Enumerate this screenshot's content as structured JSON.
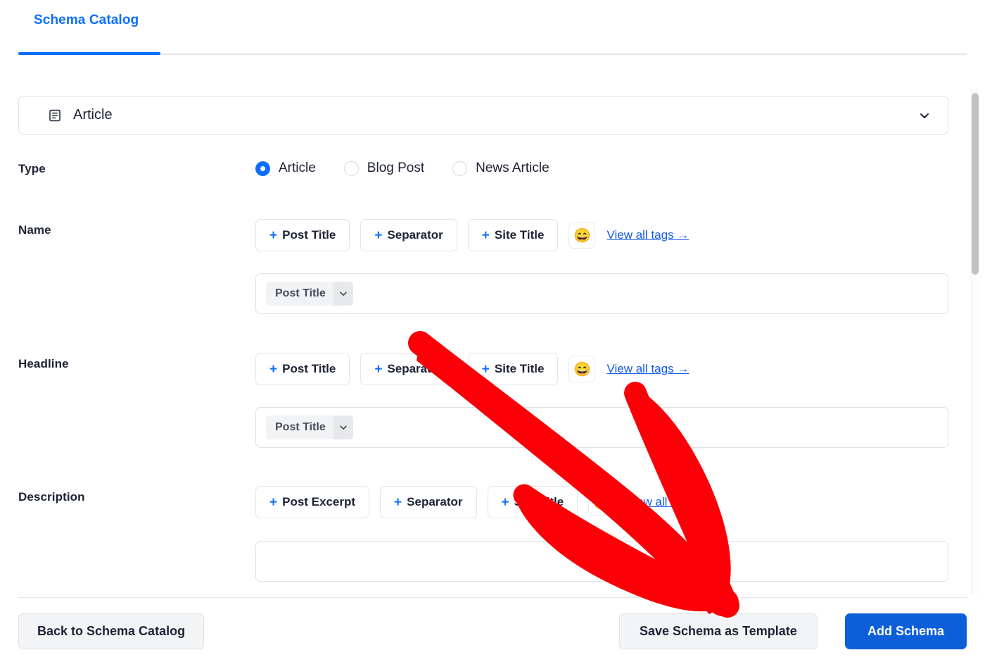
{
  "tabs": [
    {
      "label": "Schema Catalog",
      "active": true
    }
  ],
  "schema_select": {
    "icon": "article-icon",
    "value": "Article",
    "chevron": "chevron-down-icon"
  },
  "fields": {
    "type": {
      "label": "Type",
      "options": [
        {
          "label": "Article",
          "selected": true
        },
        {
          "label": "Blog Post",
          "selected": false
        },
        {
          "label": "News Article",
          "selected": false
        }
      ]
    },
    "name": {
      "label": "Name",
      "tag_buttons": [
        "+ Post Title",
        "+ Separator",
        "+ Site Title"
      ],
      "emoji": "😄",
      "view_all": "View all tags →",
      "value_chips": [
        "Post Title"
      ]
    },
    "headline": {
      "label": "Headline",
      "tag_buttons": [
        "+ Post Title",
        "+ Separator",
        "+ Site Title"
      ],
      "emoji": "😄",
      "view_all": "View all tags →",
      "value_chips": [
        "Post Title"
      ]
    },
    "description": {
      "label": "Description",
      "tag_buttons": [
        "+ Post Excerpt",
        "+ Separator",
        "+ Site Title"
      ],
      "emoji": "😄",
      "view_all": "View all tags →",
      "value_chips": []
    }
  },
  "footer": {
    "back_label": "Back to Schema Catalog",
    "save_label": "Save Schema as Template",
    "add_label": "Add Schema"
  },
  "colors": {
    "accent_blue": "#0d6efd",
    "primary_button": "#0d5fd9",
    "link_blue": "#1559e8",
    "text_dark": "#1d2235",
    "annotation_red": "#fb0007"
  },
  "annotation": {
    "type": "hand-drawn-arrow",
    "color": "#fb0007",
    "points_to": "Save Schema as Template / Add Schema area"
  }
}
